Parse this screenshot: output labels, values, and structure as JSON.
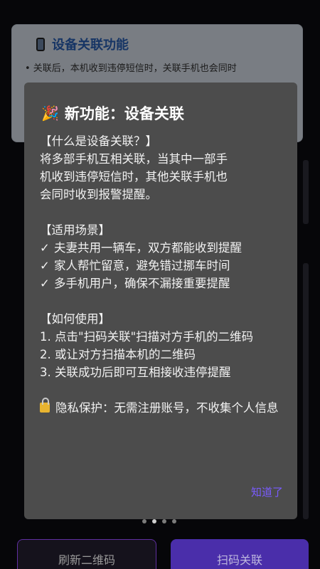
{
  "background_card": {
    "title": "设备关联功能",
    "text": "• 关联后，本机收到违停短信时，关联手机也会同时"
  },
  "dialog": {
    "emoji": "🎉",
    "title": "新功能：设备关联",
    "what_heading": "【什么是设备关联？】",
    "what_line1": "将多部手机互相关联，当其中一部手",
    "what_line2": "机收到违停短信时，其他关联手机也",
    "what_line3": "会同时收到报警提醒。",
    "scene_heading": "【适用场景】",
    "scenes": [
      "夫妻共用一辆车，双方都能收到提醒",
      "家人帮忙留意，避免错过挪车时间",
      "多手机用户，确保不漏接重要提醒"
    ],
    "check_mark": "✓",
    "howto_heading": "【如何使用】",
    "steps": [
      "1. 点击\"扫码关联\"扫描对方手机的二维码",
      "2. 或让对方扫描本机的二维码",
      "3. 关联成功后即可互相接收违停提醒"
    ],
    "privacy": "隐私保护：无需注册账号，不收集个人信息",
    "confirm_link": "知道了"
  },
  "pager": {
    "total": 4,
    "active": 1
  },
  "buttons": {
    "refresh": "刷新二维码",
    "scan": "扫码关联"
  },
  "colors": {
    "dialog_bg": "#4c4c4c",
    "accent": "#7a5cff",
    "card_title": "#2a62b8"
  }
}
